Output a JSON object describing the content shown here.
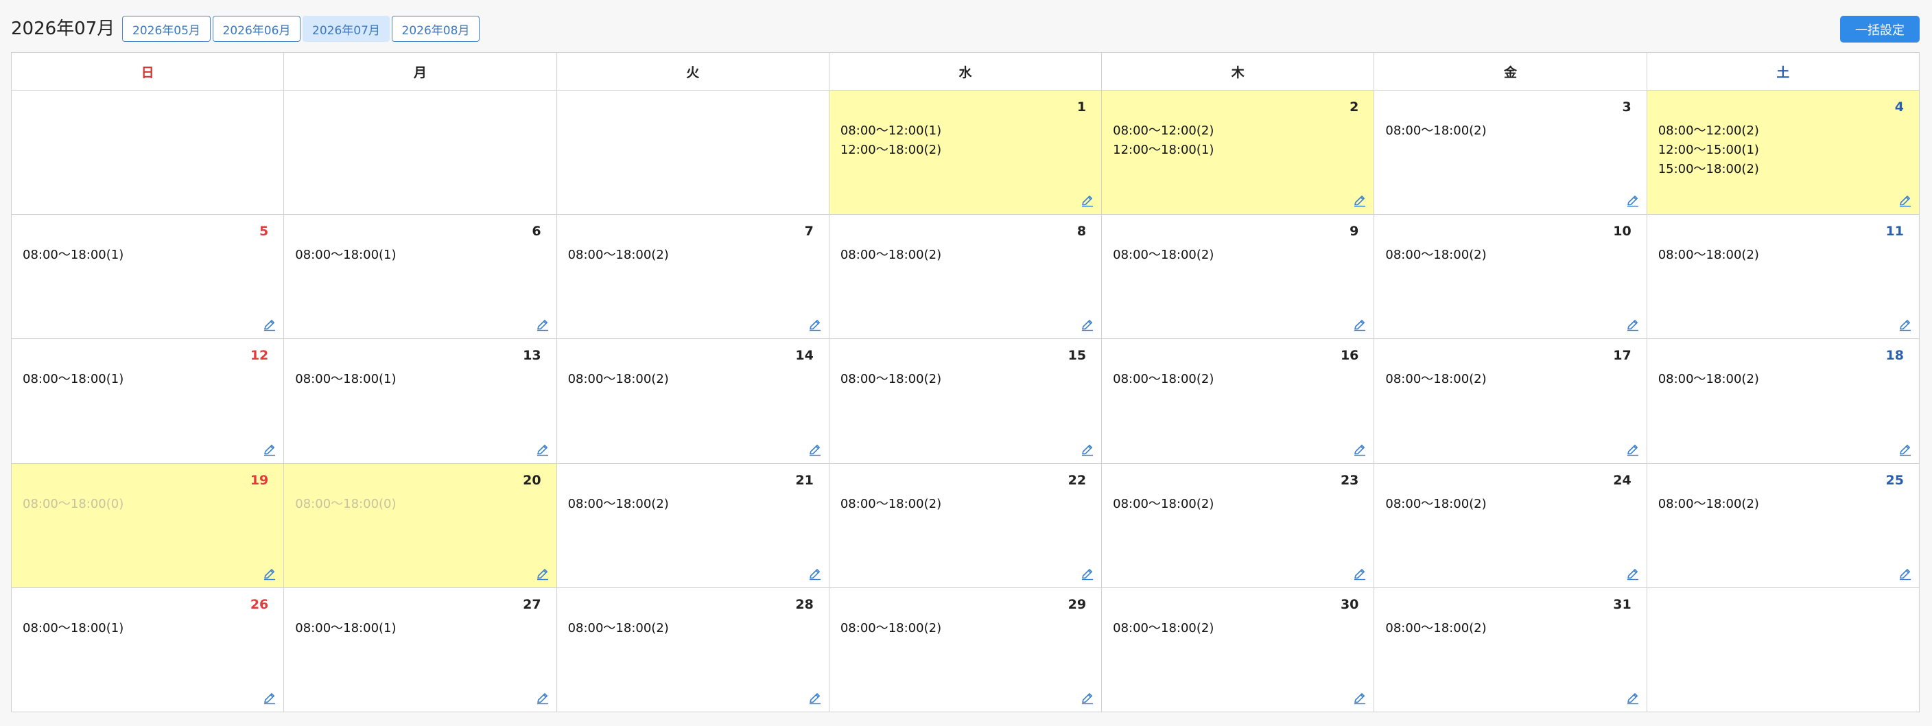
{
  "header": {
    "title": "2026年07月",
    "months": [
      {
        "label": "2026年05月",
        "active": false
      },
      {
        "label": "2026年06月",
        "active": false
      },
      {
        "label": "2026年07月",
        "active": true
      },
      {
        "label": "2026年08月",
        "active": false
      }
    ],
    "bulk_label": "一括設定"
  },
  "calendar": {
    "weekdays": [
      "日",
      "月",
      "火",
      "水",
      "木",
      "金",
      "土"
    ],
    "weeks": [
      [
        null,
        null,
        null,
        {
          "day": "1",
          "highlight": true,
          "slots": [
            {
              "text": "08:00〜12:00(1)"
            },
            {
              "text": "12:00〜18:00(2)"
            }
          ]
        },
        {
          "day": "2",
          "highlight": true,
          "slots": [
            {
              "text": "08:00〜12:00(2)"
            },
            {
              "text": "12:00〜18:00(1)"
            }
          ]
        },
        {
          "day": "3",
          "highlight": false,
          "slots": [
            {
              "text": "08:00〜18:00(2)"
            }
          ]
        },
        {
          "day": "4",
          "highlight": true,
          "slots": [
            {
              "text": "08:00〜12:00(2)"
            },
            {
              "text": "12:00〜15:00(1)"
            },
            {
              "text": "15:00〜18:00(2)"
            }
          ]
        }
      ],
      [
        {
          "day": "5",
          "highlight": false,
          "slots": [
            {
              "text": "08:00〜18:00(1)"
            }
          ]
        },
        {
          "day": "6",
          "highlight": false,
          "slots": [
            {
              "text": "08:00〜18:00(1)"
            }
          ]
        },
        {
          "day": "7",
          "highlight": false,
          "slots": [
            {
              "text": "08:00〜18:00(2)"
            }
          ]
        },
        {
          "day": "8",
          "highlight": false,
          "slots": [
            {
              "text": "08:00〜18:00(2)"
            }
          ]
        },
        {
          "day": "9",
          "highlight": false,
          "slots": [
            {
              "text": "08:00〜18:00(2)"
            }
          ]
        },
        {
          "day": "10",
          "highlight": false,
          "slots": [
            {
              "text": "08:00〜18:00(2)"
            }
          ]
        },
        {
          "day": "11",
          "highlight": false,
          "slots": [
            {
              "text": "08:00〜18:00(2)"
            }
          ]
        }
      ],
      [
        {
          "day": "12",
          "highlight": false,
          "slots": [
            {
              "text": "08:00〜18:00(1)"
            }
          ]
        },
        {
          "day": "13",
          "highlight": false,
          "slots": [
            {
              "text": "08:00〜18:00(1)"
            }
          ]
        },
        {
          "day": "14",
          "highlight": false,
          "slots": [
            {
              "text": "08:00〜18:00(2)"
            }
          ]
        },
        {
          "day": "15",
          "highlight": false,
          "slots": [
            {
              "text": "08:00〜18:00(2)"
            }
          ]
        },
        {
          "day": "16",
          "highlight": false,
          "slots": [
            {
              "text": "08:00〜18:00(2)"
            }
          ]
        },
        {
          "day": "17",
          "highlight": false,
          "slots": [
            {
              "text": "08:00〜18:00(2)"
            }
          ]
        },
        {
          "day": "18",
          "highlight": false,
          "slots": [
            {
              "text": "08:00〜18:00(2)"
            }
          ]
        }
      ],
      [
        {
          "day": "19",
          "highlight": true,
          "slots": [
            {
              "text": "08:00〜18:00(0)",
              "dim": true
            }
          ]
        },
        {
          "day": "20",
          "highlight": true,
          "slots": [
            {
              "text": "08:00〜18:00(0)",
              "dim": true
            }
          ]
        },
        {
          "day": "21",
          "highlight": false,
          "slots": [
            {
              "text": "08:00〜18:00(2)"
            }
          ]
        },
        {
          "day": "22",
          "highlight": false,
          "slots": [
            {
              "text": "08:00〜18:00(2)"
            }
          ]
        },
        {
          "day": "23",
          "highlight": false,
          "slots": [
            {
              "text": "08:00〜18:00(2)"
            }
          ]
        },
        {
          "day": "24",
          "highlight": false,
          "slots": [
            {
              "text": "08:00〜18:00(2)"
            }
          ]
        },
        {
          "day": "25",
          "highlight": false,
          "slots": [
            {
              "text": "08:00〜18:00(2)"
            }
          ]
        }
      ],
      [
        {
          "day": "26",
          "highlight": false,
          "slots": [
            {
              "text": "08:00〜18:00(1)"
            }
          ]
        },
        {
          "day": "27",
          "highlight": false,
          "slots": [
            {
              "text": "08:00〜18:00(1)"
            }
          ]
        },
        {
          "day": "28",
          "highlight": false,
          "slots": [
            {
              "text": "08:00〜18:00(2)"
            }
          ]
        },
        {
          "day": "29",
          "highlight": false,
          "slots": [
            {
              "text": "08:00〜18:00(2)"
            }
          ]
        },
        {
          "day": "30",
          "highlight": false,
          "slots": [
            {
              "text": "08:00〜18:00(2)"
            }
          ]
        },
        {
          "day": "31",
          "highlight": false,
          "slots": [
            {
              "text": "08:00〜18:00(2)"
            }
          ]
        },
        null
      ]
    ]
  },
  "icons": {
    "edit": "pencil-icon"
  },
  "colors": {
    "highlight": "#fffcab",
    "sunday": "#e23c3c",
    "saturday": "#2a5fad",
    "accent": "#2f8ae8",
    "dim_text": "#c7c3a0"
  }
}
